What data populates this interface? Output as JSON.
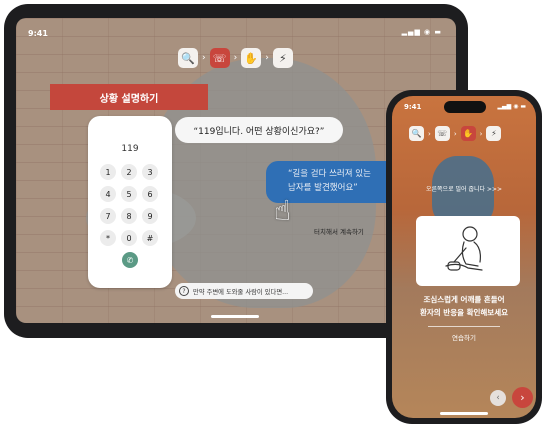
{
  "tablet": {
    "status_time": "9:41",
    "status_icons": "▂▄▆ ◉ ▬",
    "steps": [
      {
        "icon": "search-icon",
        "glyph": "🔍",
        "active": false
      },
      {
        "icon": "talk-icon",
        "glyph": "☏",
        "active": true
      },
      {
        "icon": "hands-icon",
        "glyph": "✋",
        "active": false
      },
      {
        "icon": "defib-icon",
        "glyph": "⚡",
        "active": false
      }
    ],
    "step_arrow": "›",
    "banner": "상황 설명하기",
    "keypad": {
      "number": "119",
      "keys": [
        "1",
        "2",
        "3",
        "4",
        "5",
        "6",
        "7",
        "8",
        "9",
        "*",
        "0",
        "#"
      ],
      "call_glyph": "✆"
    },
    "dispatcher_bubble": "“119입니다. 어떤 상황이신가요?”",
    "user_bubble_line1": "“길을 걷다 쓰러져 있는",
    "user_bubble_line2": "남자를 발견했어요”",
    "hand_glyph": "☝",
    "touch_hint": "터치해서 계속하기",
    "help_glyph": "?",
    "help_hint": "만약 주변에 도와줄 사람이 있다면..."
  },
  "phone": {
    "status_time": "9:41",
    "status_icons": "▂▄▆ ◉ ▬",
    "steps": [
      {
        "icon": "search-icon",
        "glyph": "🔍",
        "active": false
      },
      {
        "icon": "talk-icon",
        "glyph": "☏",
        "active": false
      },
      {
        "icon": "hands-icon",
        "glyph": "✋",
        "active": true
      },
      {
        "icon": "defib-icon",
        "glyph": "⚡",
        "active": false
      }
    ],
    "step_arrow": "›",
    "swipe_hint": "오른쪽으로 밀어 줍니다 >>>",
    "instruction_line1": "조심스럽게 어깨를 흔들어",
    "instruction_line2": "환자의 반응을 확인해보세요",
    "practice_label": "연습하기",
    "prev_glyph": "‹",
    "next_glyph": "›"
  },
  "colors": {
    "accent_red": "#c8463d",
    "call_green": "#5b9a85",
    "user_bubble_blue": "#2f6fb5"
  }
}
